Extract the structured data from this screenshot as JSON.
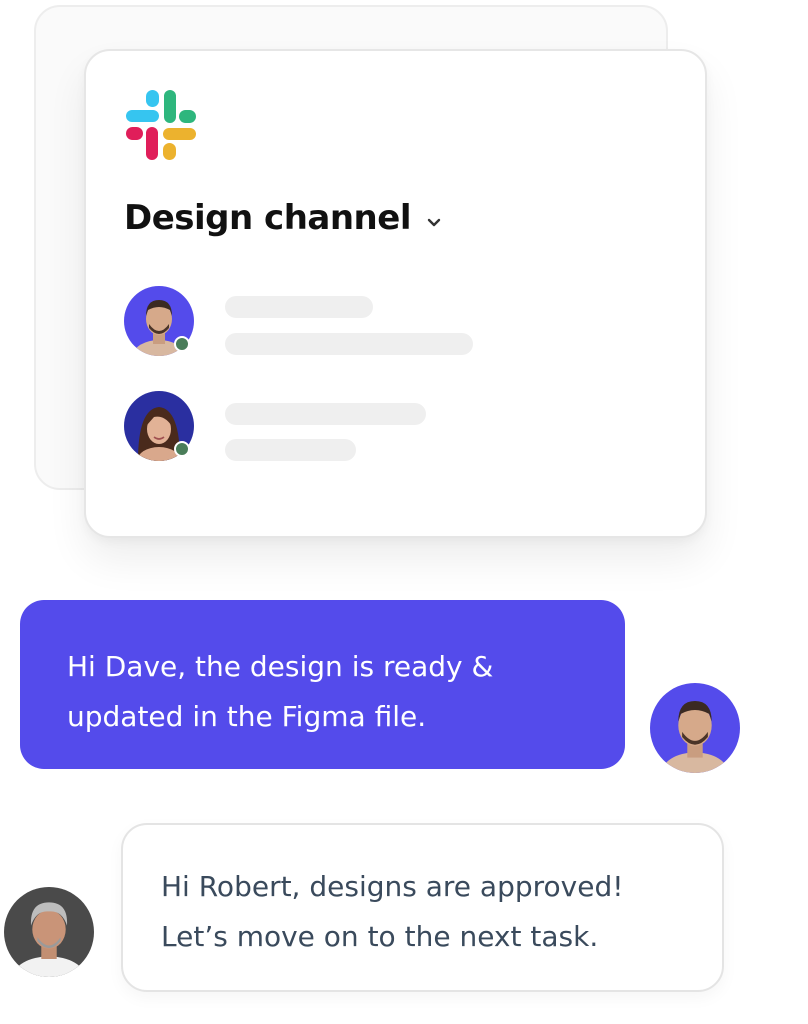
{
  "channel": {
    "logo_icon": "slack-logo-icon",
    "title": "Design channel",
    "dropdown_icon": "chevron-down-icon"
  },
  "members": [
    {
      "avatar_icon": "man-avatar-icon",
      "status": "online",
      "status_color": "#4a7d59"
    },
    {
      "avatar_icon": "woman-avatar-icon",
      "status": "online",
      "status_color": "#4a7d59"
    }
  ],
  "messages": [
    {
      "direction": "sent",
      "lines": [
        "Hi Dave, the design is ready &",
        "updated in the Figma file."
      ],
      "avatar_icon": "man-avatar-icon"
    },
    {
      "direction": "received",
      "lines": [
        "Hi Robert, designs are approved!",
        "Let’s move on to the next task."
      ],
      "avatar_icon": "gray-haired-man-avatar-icon"
    }
  ],
  "colors": {
    "accent": "#544beb",
    "online": "#4a7d59",
    "slack_blue": "#36c5f0",
    "slack_green": "#2eb67d",
    "slack_red": "#e01e5a",
    "slack_yellow": "#ecb22e"
  }
}
